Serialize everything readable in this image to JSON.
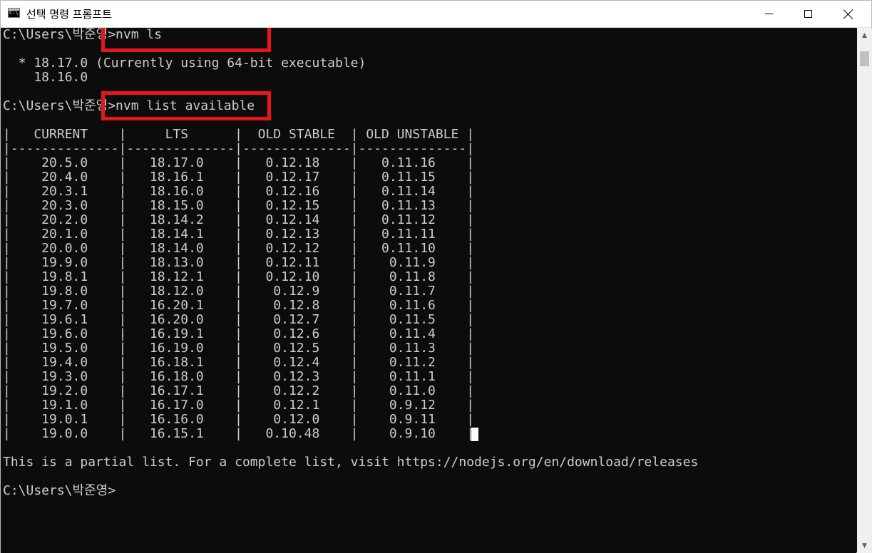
{
  "window": {
    "title": "선택 명령 프롬프트",
    "icon": "cmd-icon",
    "icon_label": "C:\\"
  },
  "console": {
    "lines": [
      "C:\\Users\\박준영>nvm ls",
      "",
      "  * 18.17.0 (Currently using 64-bit executable)",
      "    18.16.0",
      "",
      "C:\\Users\\박준영>nvm list available",
      "",
      "|   CURRENT    |     LTS      |  OLD STABLE  | OLD UNSTABLE |",
      "|--------------|--------------|--------------|--------------|",
      "|    20.5.0    |   18.17.0    |   0.12.18    |   0.11.16    |",
      "|    20.4.0    |   18.16.1    |   0.12.17    |   0.11.15    |",
      "|    20.3.1    |   18.16.0    |   0.12.16    |   0.11.14    |",
      "|    20.3.0    |   18.15.0    |   0.12.15    |   0.11.13    |",
      "|    20.2.0    |   18.14.2    |   0.12.14    |   0.11.12    |",
      "|    20.1.0    |   18.14.1    |   0.12.13    |   0.11.11    |",
      "|    20.0.0    |   18.14.0    |   0.12.12    |   0.11.10    |",
      "|    19.9.0    |   18.13.0    |   0.12.11    |    0.11.9    |",
      "|    19.8.1    |   18.12.1    |   0.12.10    |    0.11.8    |",
      "|    19.8.0    |   18.12.0    |    0.12.9    |    0.11.7    |",
      "|    19.7.0    |   16.20.1    |    0.12.8    |    0.11.6    |",
      "|    19.6.1    |   16.20.0    |    0.12.7    |    0.11.5    |",
      "|    19.6.0    |   16.19.1    |    0.12.6    |    0.11.4    |",
      "|    19.5.0    |   16.19.0    |    0.12.5    |    0.11.3    |",
      "|    19.4.0    |   16.18.1    |    0.12.4    |    0.11.2    |",
      "|    19.3.0    |   16.18.0    |    0.12.3    |    0.11.1    |",
      "|    19.2.0    |   16.17.1    |    0.12.2    |    0.11.0    |",
      "|    19.1.0    |   16.17.0    |    0.12.1    |    0.9.12    |",
      "|    19.0.1    |   16.16.0    |    0.12.0    |    0.9.11    |",
      "|    19.0.0    |   16.15.1    |   0.10.48    |    0.9.10    |",
      "",
      "This is a partial list. For a complete list, visit https://nodejs.org/en/download/releases",
      "",
      "C:\\Users\\박준영>"
    ]
  },
  "highlight_color": "#e8151b"
}
